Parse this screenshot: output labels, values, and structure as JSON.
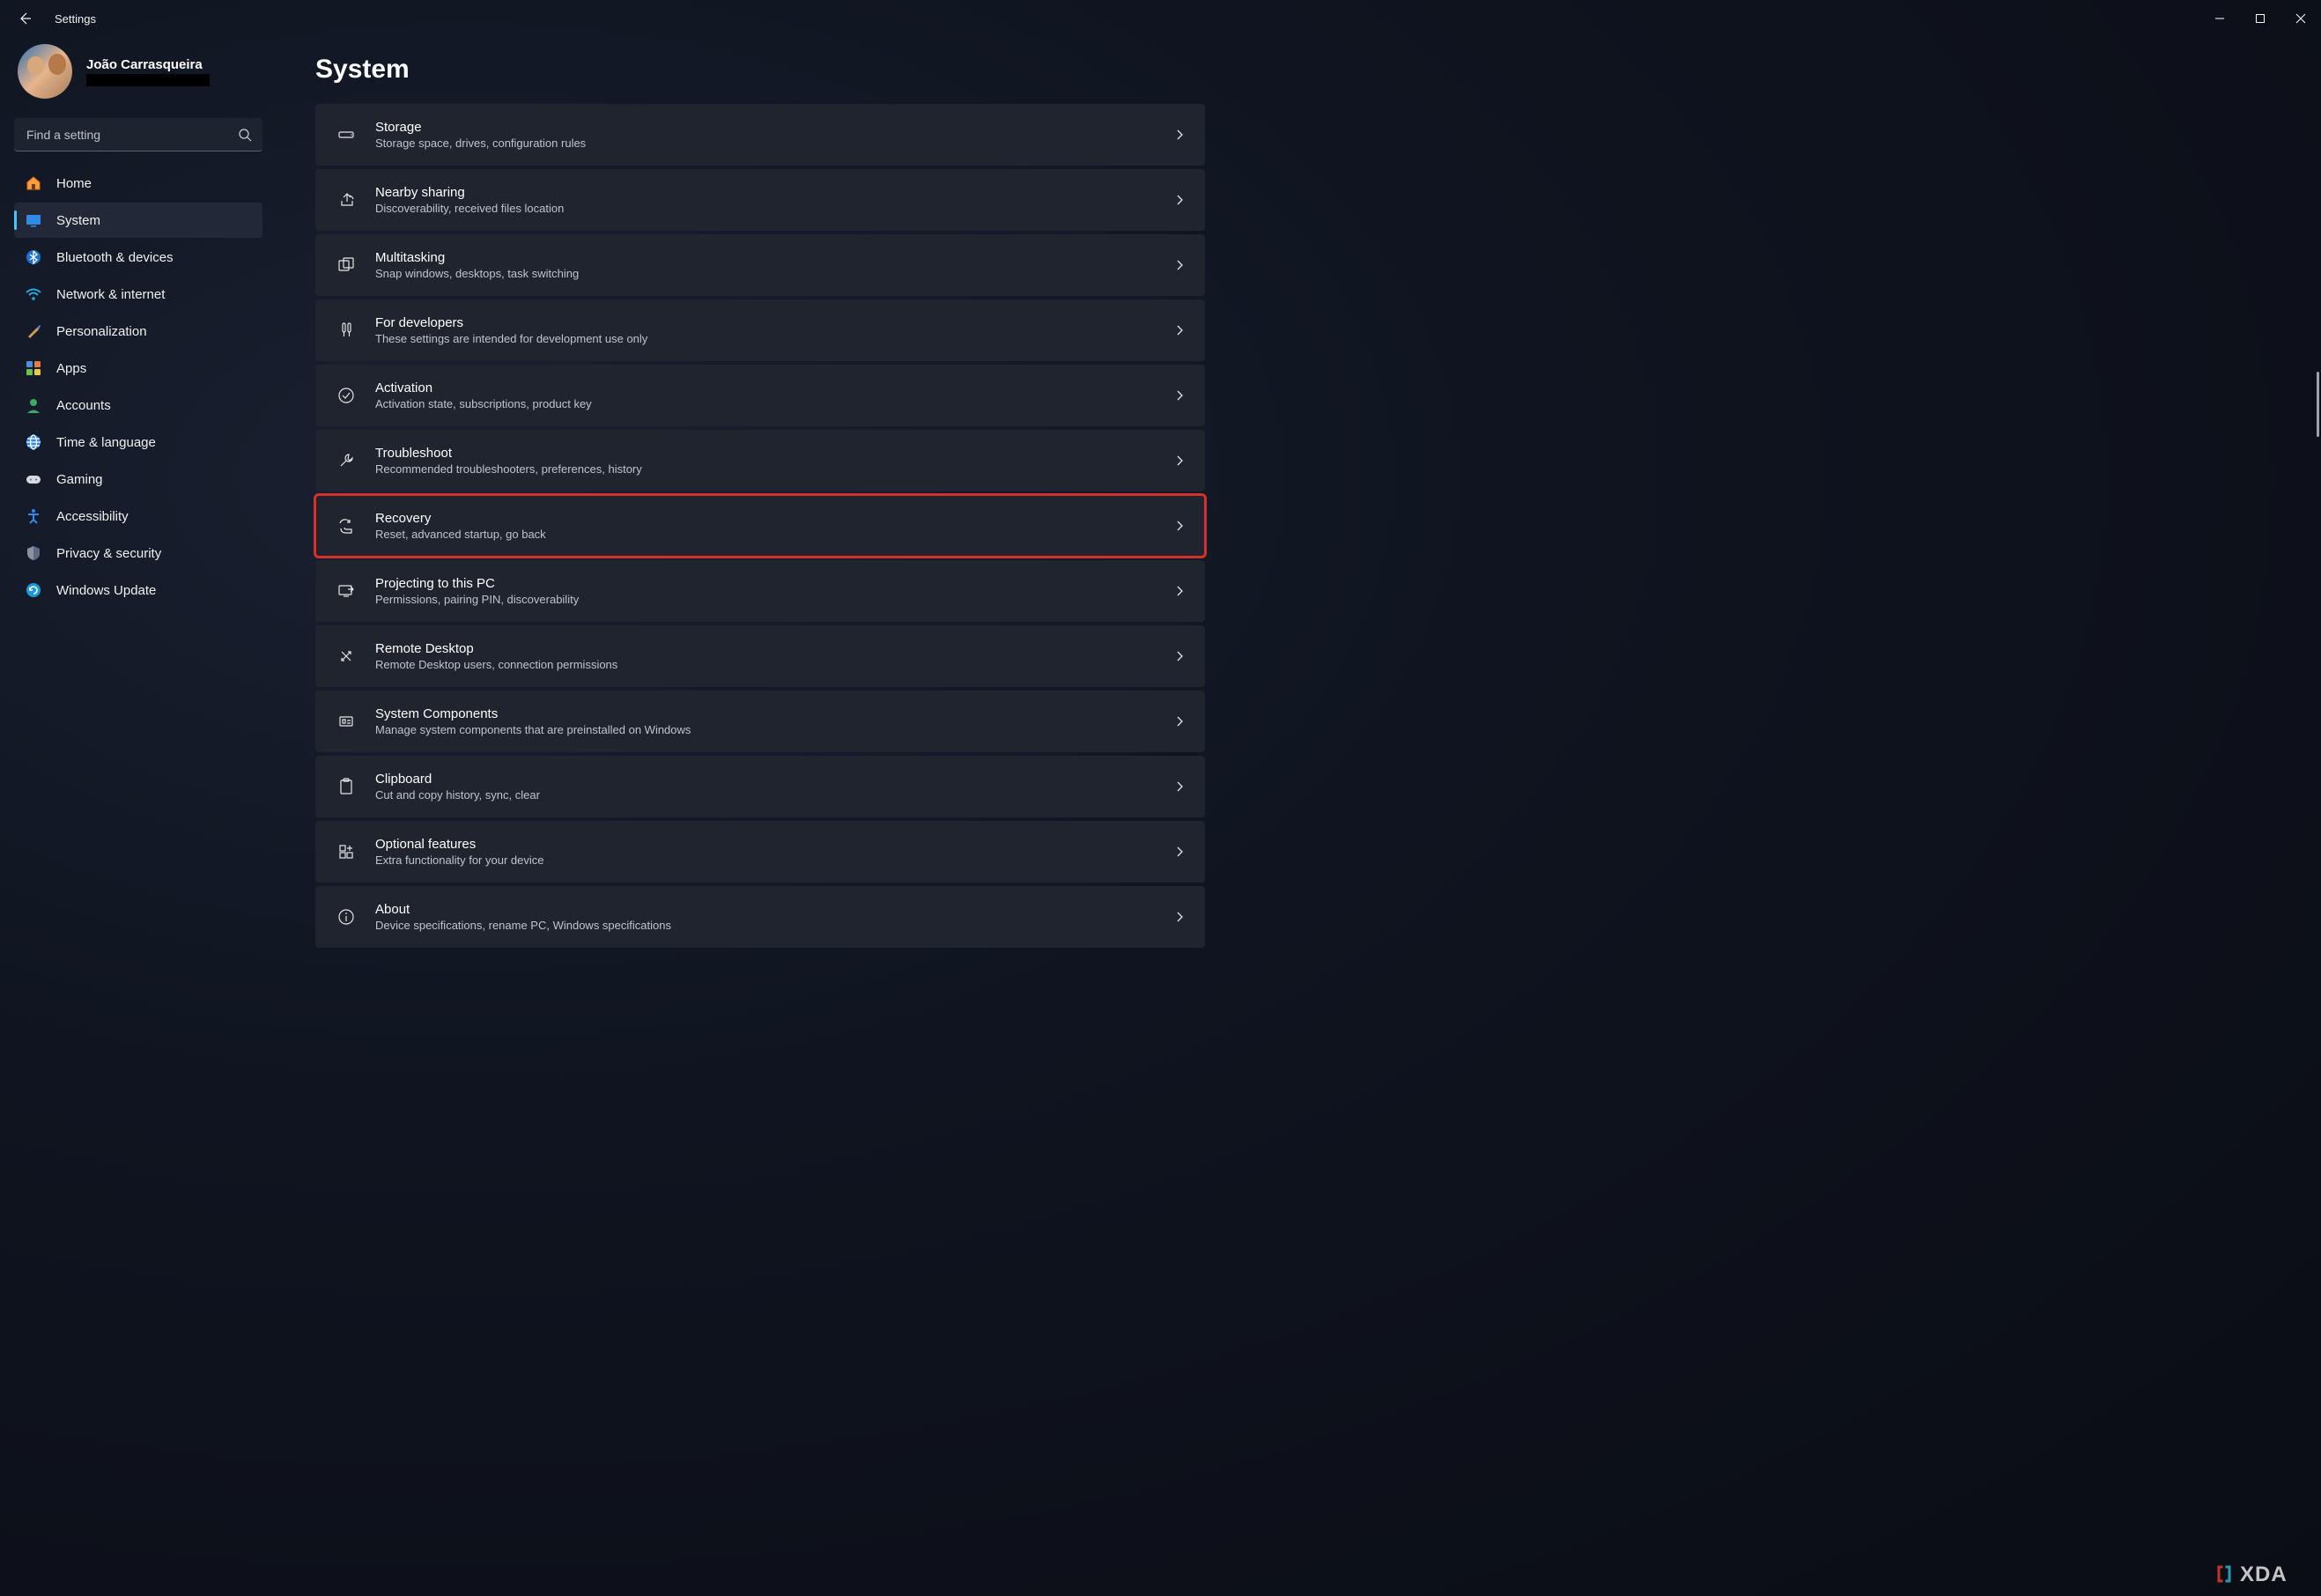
{
  "titlebar": {
    "title": "Settings"
  },
  "profile": {
    "name": "João Carrasqueira"
  },
  "search": {
    "placeholder": "Find a setting"
  },
  "page": {
    "title": "System"
  },
  "nav": [
    {
      "label": "Home",
      "icon": "home"
    },
    {
      "label": "System",
      "icon": "system",
      "active": true
    },
    {
      "label": "Bluetooth & devices",
      "icon": "bluetooth"
    },
    {
      "label": "Network & internet",
      "icon": "wifi"
    },
    {
      "label": "Personalization",
      "icon": "brush"
    },
    {
      "label": "Apps",
      "icon": "apps"
    },
    {
      "label": "Accounts",
      "icon": "account"
    },
    {
      "label": "Time & language",
      "icon": "globe"
    },
    {
      "label": "Gaming",
      "icon": "gaming"
    },
    {
      "label": "Accessibility",
      "icon": "accessibility"
    },
    {
      "label": "Privacy & security",
      "icon": "privacy"
    },
    {
      "label": "Windows Update",
      "icon": "update"
    }
  ],
  "cards": [
    {
      "title": "Storage",
      "sub": "Storage space, drives, configuration rules",
      "icon": "storage"
    },
    {
      "title": "Nearby sharing",
      "sub": "Discoverability, received files location",
      "icon": "share"
    },
    {
      "title": "Multitasking",
      "sub": "Snap windows, desktops, task switching",
      "icon": "multitask"
    },
    {
      "title": "For developers",
      "sub": "These settings are intended for development use only",
      "icon": "developer"
    },
    {
      "title": "Activation",
      "sub": "Activation state, subscriptions, product key",
      "icon": "activation"
    },
    {
      "title": "Troubleshoot",
      "sub": "Recommended troubleshooters, preferences, history",
      "icon": "troubleshoot"
    },
    {
      "title": "Recovery",
      "sub": "Reset, advanced startup, go back",
      "icon": "recovery",
      "highlighted": true
    },
    {
      "title": "Projecting to this PC",
      "sub": "Permissions, pairing PIN, discoverability",
      "icon": "project"
    },
    {
      "title": "Remote Desktop",
      "sub": "Remote Desktop users, connection permissions",
      "icon": "remote"
    },
    {
      "title": "System Components",
      "sub": "Manage system components that are preinstalled on Windows",
      "icon": "components"
    },
    {
      "title": "Clipboard",
      "sub": "Cut and copy history, sync, clear",
      "icon": "clipboard"
    },
    {
      "title": "Optional features",
      "sub": "Extra functionality for your device",
      "icon": "optional"
    },
    {
      "title": "About",
      "sub": "Device specifications, rename PC, Windows specifications",
      "icon": "about"
    }
  ],
  "watermark": {
    "text": "XDA"
  }
}
